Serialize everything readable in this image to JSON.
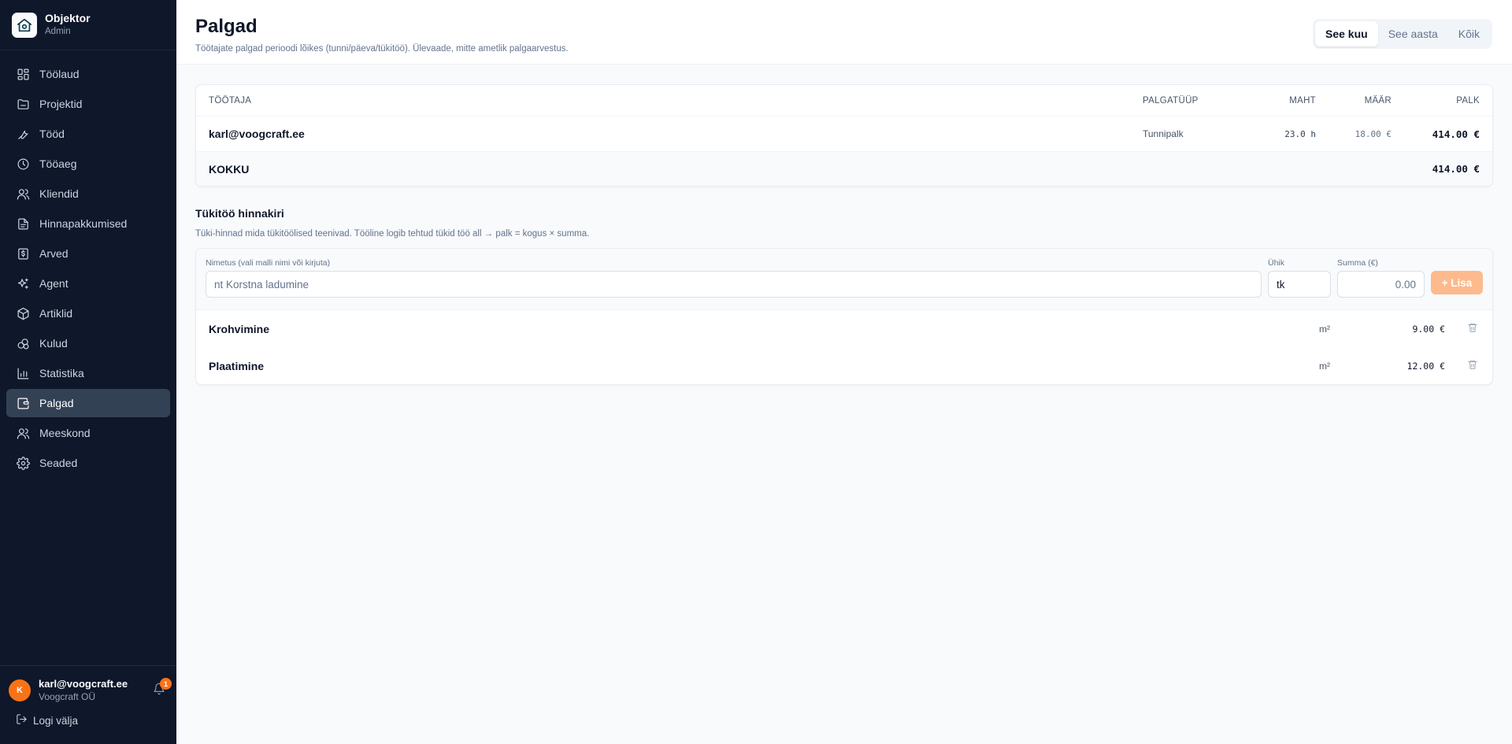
{
  "brand": {
    "name": "Objektor",
    "role": "Admin"
  },
  "nav": [
    {
      "label": "Töölaud",
      "icon": "dashboard-icon"
    },
    {
      "label": "Projektid",
      "icon": "folder-icon"
    },
    {
      "label": "Tööd",
      "icon": "wrench-icon"
    },
    {
      "label": "Tööaeg",
      "icon": "clock-icon"
    },
    {
      "label": "Kliendid",
      "icon": "users-icon"
    },
    {
      "label": "Hinnapakkumised",
      "icon": "document-icon"
    },
    {
      "label": "Arved",
      "icon": "invoice-icon"
    },
    {
      "label": "Agent",
      "icon": "sparkles-icon"
    },
    {
      "label": "Artiklid",
      "icon": "package-icon"
    },
    {
      "label": "Kulud",
      "icon": "coins-icon"
    },
    {
      "label": "Statistika",
      "icon": "bar-chart-icon"
    },
    {
      "label": "Palgad",
      "icon": "wallet-icon",
      "active": true
    },
    {
      "label": "Meeskond",
      "icon": "team-icon"
    },
    {
      "label": "Seaded",
      "icon": "gear-icon"
    }
  ],
  "user": {
    "initial": "K",
    "email": "karl@voogcraft.ee",
    "company": "Voogcraft OÜ",
    "notifications": "1"
  },
  "logout": "Logi välja",
  "page": {
    "title": "Palgad",
    "subtitle": "Töötajate palgad perioodi lõikes (tunni/päeva/tükitöö). Ülevaade, mitte ametlik palgaarvestus."
  },
  "period": {
    "options": [
      "See kuu",
      "See aasta",
      "Kõik"
    ],
    "active": "See kuu"
  },
  "wages": {
    "headers": {
      "employee": "TÖÖTAJA",
      "type": "PALGATÜÜP",
      "volume": "MAHT",
      "rate": "MÄÄR",
      "wage": "PALK"
    },
    "rows": [
      {
        "employee": "karl@voogcraft.ee",
        "type": "Tunnipalk",
        "volume": "23.0 h",
        "rate": "18.00 €",
        "wage": "414.00 €"
      }
    ],
    "total": {
      "label": "KOKKU",
      "wage": "414.00 €"
    }
  },
  "price_list": {
    "title": "Tükitöö hinnakiri",
    "subtitle": "Tüki-hinnad mida tükitöölised teenivad. Tööline logib tehtud tükid töö all → palk = kogus × summa.",
    "form": {
      "name_label": "Nimetus (vali malli nimi või kirjuta)",
      "name_placeholder": "nt Korstna ladumine",
      "unit_label": "Ühik",
      "unit_value": "tk",
      "sum_label": "Summa (€)",
      "sum_placeholder": "0.00",
      "add_label": "+ Lisa"
    },
    "items": [
      {
        "name": "Krohvimine",
        "unit": "m²",
        "sum": "9.00 €"
      },
      {
        "name": "Plaatimine",
        "unit": "m²",
        "sum": "12.00 €"
      }
    ]
  }
}
